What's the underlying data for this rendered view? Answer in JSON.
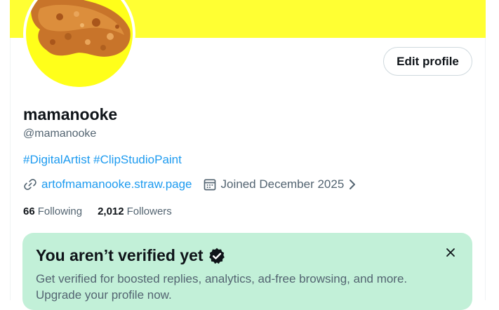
{
  "profile": {
    "name": "mamanooke",
    "handle": "@mamanooke",
    "bio_tags": [
      "#DigitalArtist",
      "#ClipStudioPaint"
    ],
    "website": "artofmamanooke.straw.page",
    "joined": "Joined December 2025",
    "edit_label": "Edit profile",
    "banner_color": "#ffff33"
  },
  "stats": {
    "following_count": "66",
    "following_label": "Following",
    "followers_count": "2,012",
    "followers_label": "Followers"
  },
  "verify_card": {
    "title": "You aren’t verified yet",
    "text": "Get verified for boosted replies, analytics, ad-free browsing, and more. Upgrade your profile now.",
    "bg_color": "#c2f0d8"
  },
  "icons": [
    "link-icon",
    "calendar-icon",
    "chevron-right-icon",
    "verified-badge-icon",
    "close-icon"
  ],
  "colors": {
    "accent": "#1d9bf0",
    "muted": "#536471",
    "text": "#0f1419"
  }
}
